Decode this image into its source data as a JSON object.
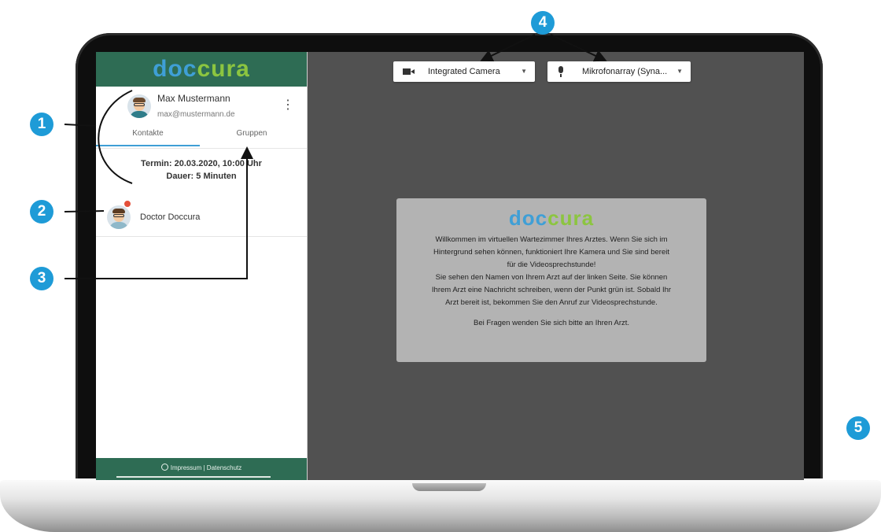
{
  "sidebar": {
    "brand": {
      "part1": "doc",
      "part2": "cura"
    },
    "user": {
      "name": "Max Mustermann",
      "email": "max@mustermann.de"
    },
    "menu_icon": "more-vert-icon",
    "tabs": [
      {
        "label": "Kontakte",
        "active": true
      },
      {
        "label": "Gruppen",
        "active": false
      }
    ],
    "appointment": {
      "line1": "Termin: 20.03.2020, 10:00 Uhr",
      "line2": "Dauer: 5 Minuten"
    },
    "contacts": [
      {
        "name": "Doctor Doccura",
        "status_color": "#e4503a"
      }
    ],
    "footer": {
      "text": "Impressum | Datenschutz"
    }
  },
  "devices": {
    "camera": {
      "label": "Integrated Camera",
      "icon": "camera-icon"
    },
    "microphone": {
      "label": "Mikrofonarray (Syna...",
      "icon": "microphone-icon"
    }
  },
  "welcome": {
    "brand": {
      "part1": "doc",
      "part2": "cura"
    },
    "line1": "Willkommen im virtuellen Wartezimmer Ihres Arztes. Wenn Sie sich im",
    "line2": "Hintergrund sehen können, funktioniert Ihre Kamera und Sie sind bereit",
    "line3": "für die Videosprechstunde!",
    "line4": "Sie sehen den Namen von Ihrem Arzt auf der linken Seite. Sie können",
    "line5": "Ihrem Arzt eine Nachricht schreiben, wenn der Punkt grün ist. Sobald Ihr",
    "line6": "Arzt bereit ist, bekommen Sie den Anruf zur Videosprechstunde.",
    "faq": "Bei Fragen wenden Sie sich bitte an Ihren Arzt."
  },
  "callouts": [
    "1",
    "2",
    "3",
    "4",
    "5"
  ],
  "colors": {
    "brand_green": "#2e6c54",
    "brand_blue": "#3f9fd6",
    "brand_lime": "#8cc540",
    "callout": "#1e9bd7",
    "screen_bg": "#515151"
  }
}
